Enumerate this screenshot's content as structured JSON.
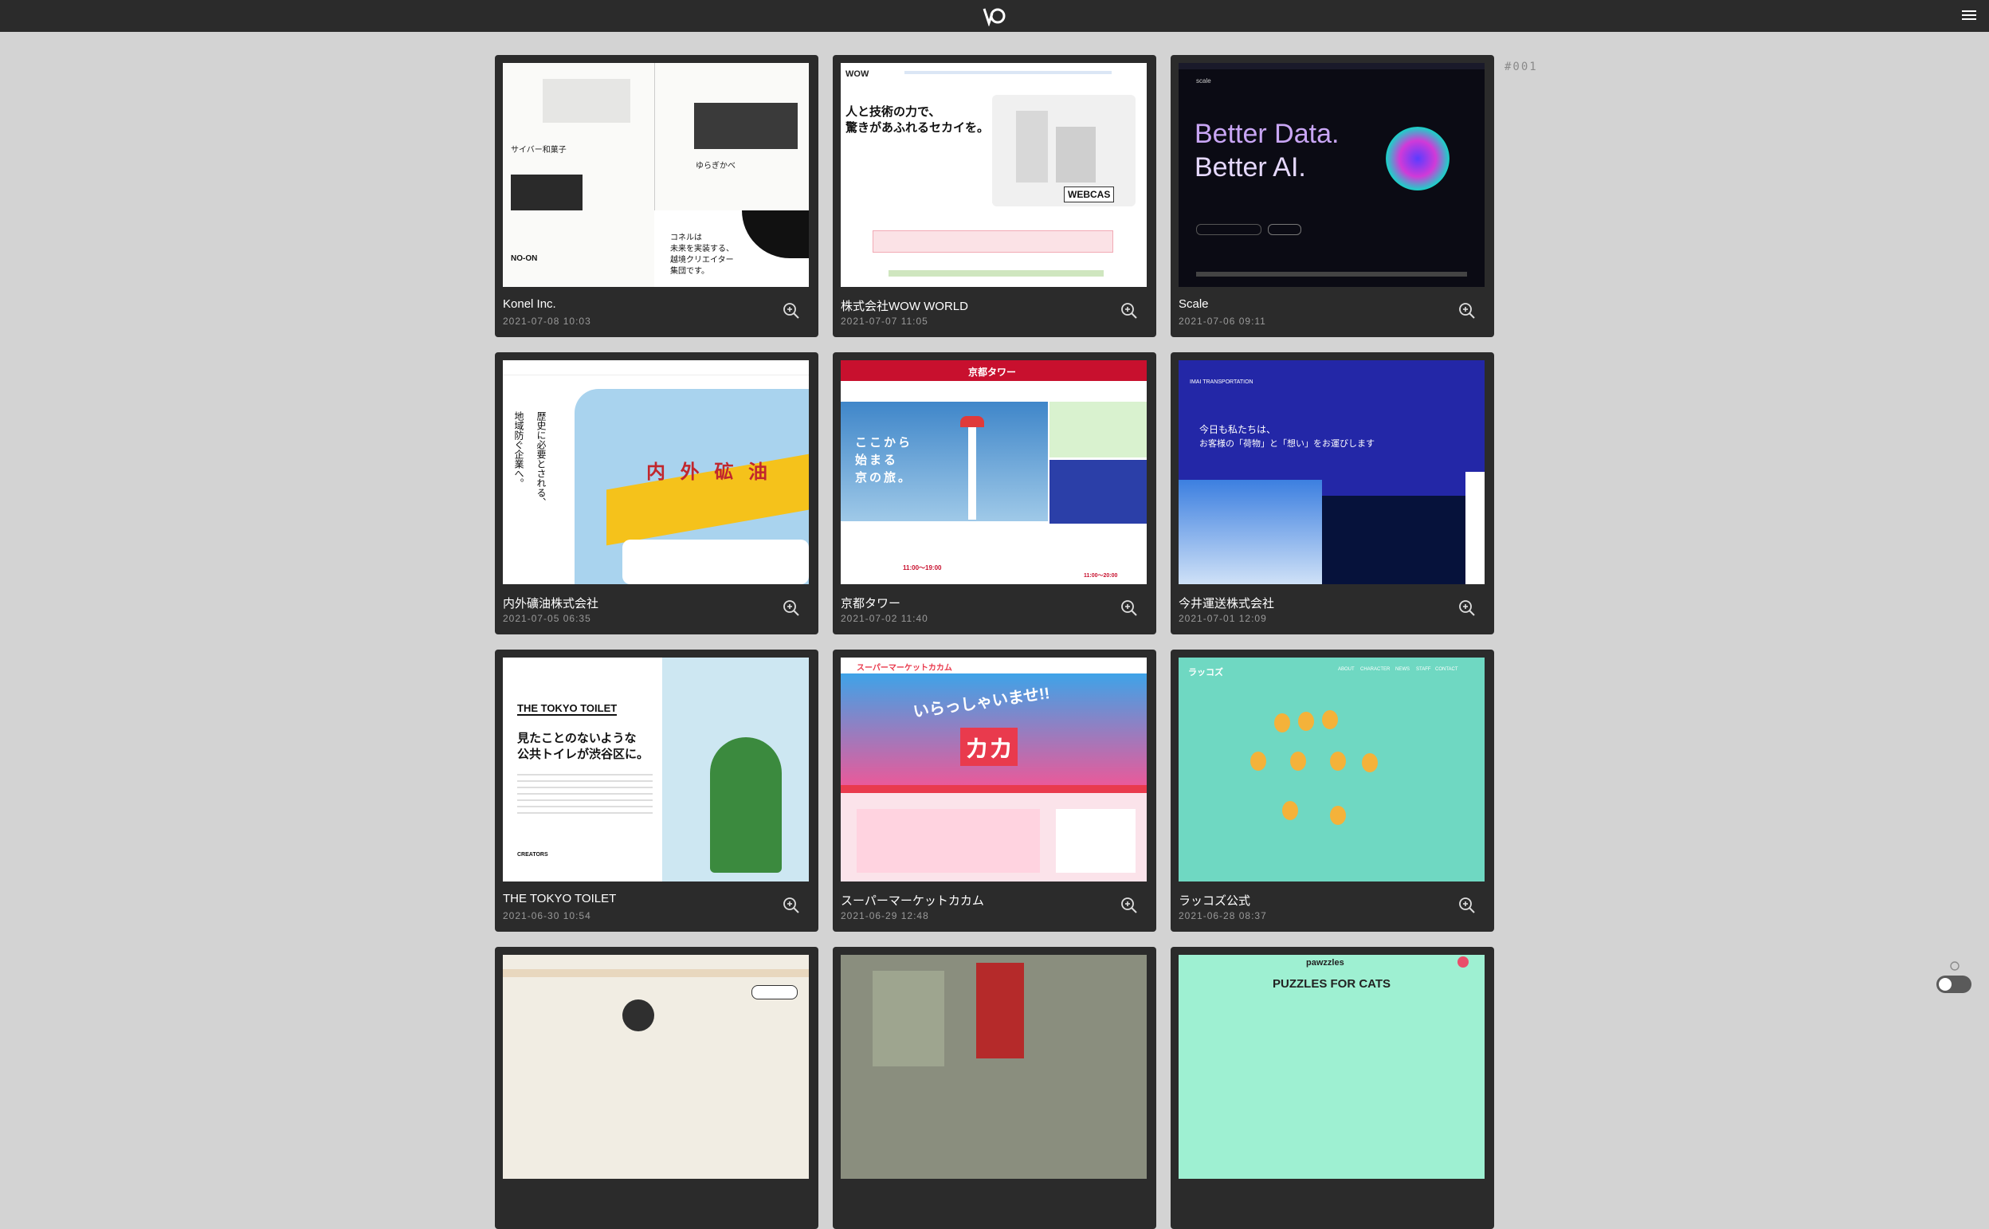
{
  "header": {
    "logo_icon": "wo-logo-icon",
    "menu_icon": "hamburger-menu-icon"
  },
  "counter": "#001",
  "cards": [
    {
      "title": "Konel Inc.",
      "date": "2021-07-08 10:03"
    },
    {
      "title": "株式会社WOW WORLD",
      "date": "2021-07-07 11:05"
    },
    {
      "title": "Scale",
      "date": "2021-07-06 09:11"
    },
    {
      "title": "内外礦油株式会社",
      "date": "2021-07-05 06:35"
    },
    {
      "title": "京都タワー",
      "date": "2021-07-02 11:40"
    },
    {
      "title": "今井運送株式会社",
      "date": "2021-07-01 12:09"
    },
    {
      "title": "THE TOKYO TOILET",
      "date": "2021-06-30 10:54"
    },
    {
      "title": "スーパーマーケットカカム",
      "date": "2021-06-29 12:48"
    },
    {
      "title": "ラッコズ公式",
      "date": "2021-06-28 08:37"
    },
    {
      "title": "",
      "date": ""
    },
    {
      "title": "",
      "date": ""
    },
    {
      "title": "",
      "date": ""
    }
  ],
  "thumbs": {
    "konel": {
      "t1": "サイバー和菓子",
      "t2": "ゆらぎかべ",
      "t3": "NO-ON",
      "t4": "コネルは",
      "t5": "未来を実装する、",
      "t6": "越境クリエイター",
      "t7": "集団です。"
    },
    "wow": {
      "brand": "WOW",
      "h1": "人と技術の力で、",
      "h2": "驚きがあふれるセカイを。",
      "badge": "WEBCAS"
    },
    "scale": {
      "brand": "scale",
      "h1": "Better Data.",
      "h2": "Better AI."
    },
    "naigai": {
      "v1": "歴史に必要とされる、",
      "v2": "地域防ぐ企業へ。",
      "sign": "内 外 砿 油"
    },
    "kyoto": {
      "brand": "京都タワー",
      "h1": "ここから",
      "h2": "始まる",
      "h3": "京の旅。",
      "time1": "11:00〜19:00",
      "time2": "11:00〜20:00"
    },
    "imai": {
      "brand": "IMAI TRANSPORTATION",
      "h1": "今日も私たちは、",
      "h2": "お客様の「荷物」と「想い」をお運びします"
    },
    "toilet": {
      "brand": "THE TOKYO TOILET",
      "h1": "見たことのないような",
      "h2": "公共トイレが渋谷区に。",
      "creators": "CREATORS"
    },
    "kakamu": {
      "brand": "スーパーマーケットカカム",
      "hero": "いらっしゃいませ!!",
      "logo": "カカ"
    },
    "rakkozu": {
      "brand": "ラッコズ",
      "nav": [
        "ABOUT",
        "CHARACTER",
        "NEWS",
        "STAFF",
        "CONTACT"
      ]
    },
    "paw": {
      "brand": "pawzzles",
      "h1": "PUZZLES FOR CATS"
    }
  }
}
